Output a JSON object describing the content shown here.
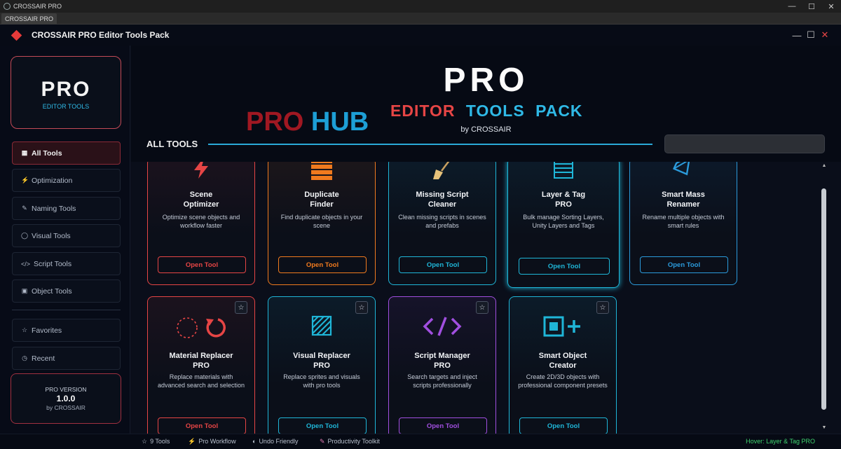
{
  "os": {
    "title": "CROSSAIR PRO",
    "tab": "CROSSAIR PRO"
  },
  "app": {
    "title": "CROSSAIR PRO Editor Tools Pack"
  },
  "brand": {
    "line1": "PRO",
    "line2": "EDITOR TOOLS"
  },
  "sidebar": {
    "items": [
      {
        "label": "All Tools",
        "icon": "grid-icon",
        "glyph": "▦",
        "active": true
      },
      {
        "label": "Optimization",
        "icon": "lightning-icon",
        "glyph": "⚡",
        "active": false
      },
      {
        "label": "Naming Tools",
        "icon": "tag-icon",
        "glyph": "✎",
        "active": false
      },
      {
        "label": "Visual Tools",
        "icon": "circle-icon",
        "glyph": "◯",
        "active": false
      },
      {
        "label": "Script Tools",
        "icon": "code-icon",
        "glyph": "</>",
        "active": false
      },
      {
        "label": "Object Tools",
        "icon": "box-icon",
        "glyph": "▣",
        "active": false
      }
    ],
    "secondary": [
      {
        "label": "Favorites",
        "icon": "star-icon",
        "glyph": "☆"
      },
      {
        "label": "Recent",
        "icon": "clock-icon",
        "glyph": "◷"
      }
    ],
    "version": {
      "label": "PRO VERSION",
      "number": "1.0.0",
      "by": "by CROSSAIR"
    }
  },
  "hero": {
    "title": "PRO",
    "editor": "EDITOR",
    "tools": "TOOLS",
    "pack": "PACK",
    "by": "by CROSSAIR",
    "hub_pro": "PRO",
    "hub_hub": "HUB",
    "section": "ALL TOOLS",
    "search_placeholder": ""
  },
  "colors": {
    "red": "#e64545",
    "orange": "#f07a1e",
    "cyan": "#1fb6d8",
    "blue": "#2b9bdc",
    "purple": "#a14fe0",
    "green": "#3fd36f"
  },
  "tools": [
    {
      "title_1": "Scene",
      "title_2": "Optimizer",
      "desc": "Optimize scene objects and workflow faster",
      "button": "Open Tool",
      "icon": "lightning-icon",
      "color": "#e64545"
    },
    {
      "title_1": "Duplicate",
      "title_2": "Finder",
      "desc": "Find duplicate objects in your scene",
      "button": "Open Tool",
      "icon": "stack-icon",
      "color": "#f07a1e"
    },
    {
      "title_1": "Missing Script",
      "title_2": "Cleaner",
      "desc": "Clean missing scripts in scenes and prefabs",
      "button": "Open Tool",
      "icon": "broom-icon",
      "color": "#1fb6d8"
    },
    {
      "title_1": "Layer & Tag",
      "title_2": "PRO",
      "desc": "Bulk manage Sorting Layers, Unity Layers and Tags",
      "button": "Open Tool",
      "icon": "layers-icon",
      "color": "#1fb6d8"
    },
    {
      "title_1": "Smart Mass",
      "title_2": "Renamer",
      "desc": "Rename multiple objects with smart rules",
      "button": "Open Tool",
      "icon": "gem-icon",
      "color": "#2b9bdc"
    },
    {
      "title_1": "Material Replacer",
      "title_2": "PRO",
      "desc": "Replace materials with advanced search and selection",
      "button": "Open Tool",
      "icon": "replace-circle-icon",
      "color": "#e64545",
      "fav": "☆"
    },
    {
      "title_1": "Visual Replacer",
      "title_2": "PRO",
      "desc": "Replace sprites and visuals with pro tools",
      "button": "Open Tool",
      "icon": "hatched-square-icon",
      "color": "#1fb6d8",
      "fav": "☆"
    },
    {
      "title_1": "Script Manager",
      "title_2": "PRO",
      "desc": "Search targets and inject scripts professionally",
      "button": "Open Tool",
      "icon": "code-icon",
      "color": "#a14fe0",
      "fav": "☆"
    },
    {
      "title_1": "Smart Object",
      "title_2": "Creator",
      "desc": "Create 2D/3D objects with professional component presets",
      "button": "Open Tool",
      "icon": "add-object-icon",
      "color": "#1fb6d8",
      "fav": "☆"
    }
  ],
  "status": {
    "tools": "9 Tools",
    "workflow": "Pro Workflow",
    "undo": "Undo Friendly",
    "toolkit": "Productivity Toolkit",
    "hover": "Hover: Layer & Tag PRO"
  }
}
